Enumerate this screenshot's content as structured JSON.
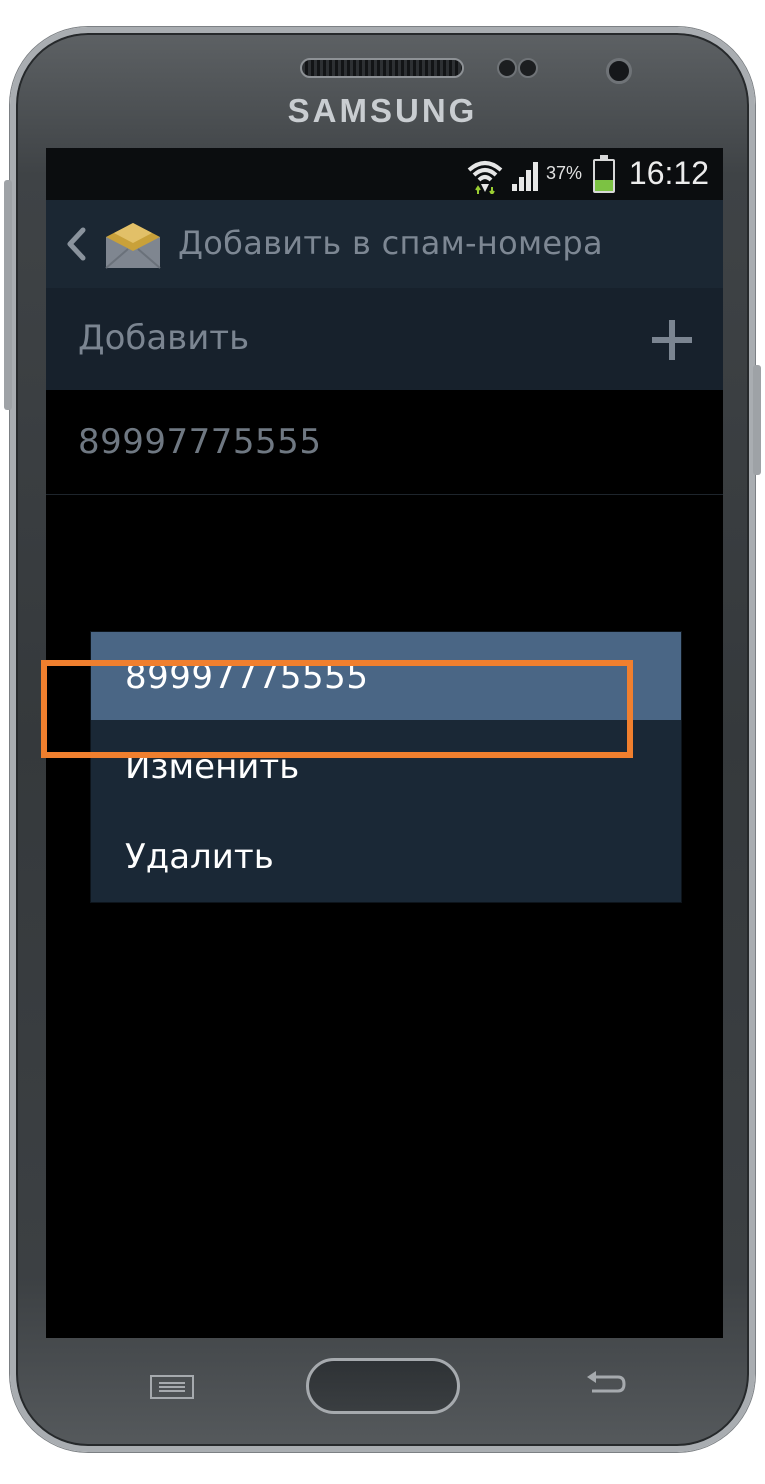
{
  "device": {
    "brand": "SAMSUNG"
  },
  "status_bar": {
    "battery_percent": "37%",
    "battery_level": 0.37,
    "time": "16:12",
    "battery_color": "#7cc243",
    "icons": [
      "wifi-icon",
      "signal-icon",
      "battery-icon"
    ]
  },
  "app_bar": {
    "back_icon": "chevron-left-icon",
    "app_icon": "envelope-icon",
    "title": "Добавить в спам-номера",
    "background": "#1b2733"
  },
  "add_row": {
    "label": "Добавить",
    "icon": "plus-icon"
  },
  "spam_list": {
    "items": [
      {
        "number": "89997775555"
      }
    ]
  },
  "context_menu": {
    "title": "89997775555",
    "header_color": "#4a6685",
    "items": [
      {
        "label": "Изменить"
      },
      {
        "label": "Удалить",
        "highlighted": true
      }
    ],
    "highlight_color": "#f07f2e"
  },
  "hardware_keys": [
    "menu-key-icon",
    "home-button",
    "back-key-icon"
  ]
}
